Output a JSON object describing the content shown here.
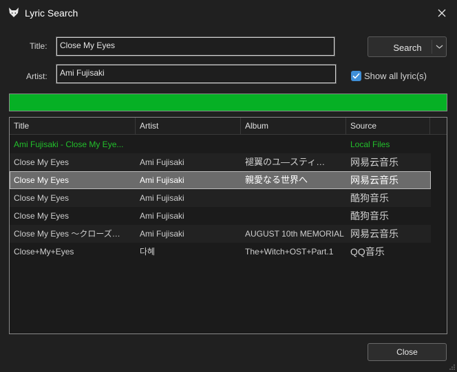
{
  "window": {
    "title": "Lyric Search",
    "icon": "fox-head-icon",
    "close_icon": "close-icon"
  },
  "form": {
    "title_label": "Title:",
    "title_value": "Close My Eyes",
    "artist_label": "Artist:",
    "artist_value": "Ami Fujisaki",
    "search_label": "Search",
    "show_all_label": "Show all lyric(s)",
    "show_all_checked": true
  },
  "progress": {
    "fraction": 1.0,
    "color": "#06b025"
  },
  "table": {
    "columns": [
      "Title",
      "Artist",
      "Album",
      "Source"
    ],
    "rows": [
      {
        "title": "Ami Fujisaki - Close My Eye...",
        "artist": "",
        "album": "",
        "source": "Local Files",
        "kind": "local"
      },
      {
        "title": "Close My Eyes",
        "artist": "Ami Fujisaki",
        "album": "褪翼のユ―スティ…",
        "source": "网易云音乐",
        "kind": "alt"
      },
      {
        "title": "Close My Eyes",
        "artist": "Ami Fujisaki",
        "album": "親愛なる世界へ",
        "source": "网易云音乐",
        "kind": "selected"
      },
      {
        "title": "Close My Eyes",
        "artist": "Ami Fujisaki",
        "album": "",
        "source": "酷狗音乐",
        "kind": "alt"
      },
      {
        "title": "Close My Eyes",
        "artist": "Ami Fujisaki",
        "album": "",
        "source": "酷狗音乐",
        "kind": ""
      },
      {
        "title": "Close My Eyes 〜クローズ…",
        "artist": "Ami Fujisaki",
        "album": "AUGUST 10th MEMORIAL",
        "source": "网易云音乐",
        "kind": "alt"
      },
      {
        "title": "Close+My+Eyes",
        "artist": "다혜",
        "album": "The+Witch+OST+Part.1",
        "source": "QQ音乐",
        "kind": ""
      }
    ]
  },
  "footer": {
    "close_label": "Close"
  },
  "colors": {
    "accent": "#3f8fd8",
    "local_text": "#22c02b",
    "selected_row": "#6b6b6b"
  }
}
